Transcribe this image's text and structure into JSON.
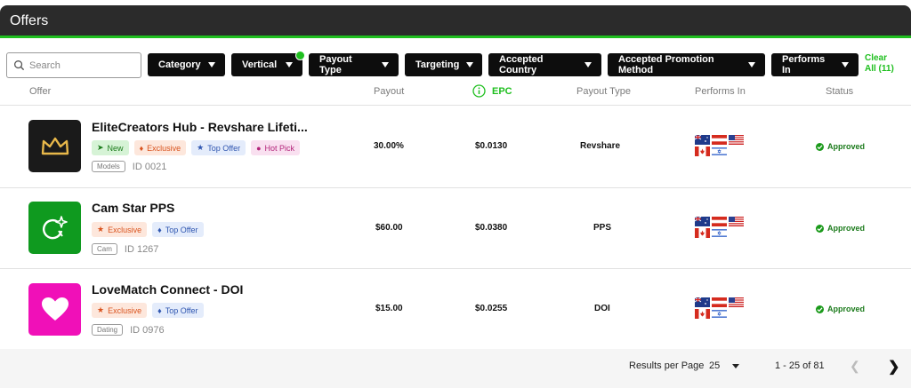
{
  "title": "Offers",
  "search": {
    "placeholder": "Search"
  },
  "filters": [
    {
      "label": "Category"
    },
    {
      "label": "Vertical"
    },
    {
      "label": "Payout Type"
    },
    {
      "label": "Targeting"
    },
    {
      "label": "Accepted Country"
    },
    {
      "label": "Accepted Promotion Method"
    },
    {
      "label": "Performs In"
    }
  ],
  "clear": {
    "line1": "Clear",
    "line2": "All (11)"
  },
  "columns": {
    "offer": "Offer",
    "payout": "Payout",
    "epc": "EPC",
    "payout_type": "Payout Type",
    "performs_in": "Performs In",
    "status": "Status"
  },
  "colors": {
    "accent": "#1fbf1f",
    "titlebar": "#2b2b2b"
  },
  "offers": [
    {
      "name": "EliteCreators Hub - Revshare Lifeti...",
      "logo_icon": "crown-icon",
      "badges": {
        "new": "New",
        "exclusive": "Exclusive",
        "top": "Top Offer",
        "hot": "Hot Pick"
      },
      "category": "Models",
      "id": "ID 0021",
      "payout": "30.00%",
      "epc": "$0.0130",
      "payout_type": "Revshare",
      "status": "Approved"
    },
    {
      "name": "Cam Star PPS",
      "logo_icon": "camera-sparkle-icon",
      "badges": {
        "exclusive": "Exclusive",
        "top": "Top Offer"
      },
      "category": "Cam",
      "id": "ID 1267",
      "payout": "$60.00",
      "epc": "$0.0380",
      "payout_type": "PPS",
      "status": "Approved"
    },
    {
      "name": "LoveMatch Connect - DOI",
      "logo_icon": "heart-icon",
      "badges": {
        "exclusive": "Exclusive",
        "top": "Top Offer"
      },
      "category": "Dating",
      "id": "ID 0976",
      "payout": "$15.00",
      "epc": "$0.0255",
      "payout_type": "DOI",
      "status": "Approved"
    }
  ],
  "pagination": {
    "results_label": "Results per Page",
    "per_page": "25",
    "range": "1 - 25 of 81"
  }
}
